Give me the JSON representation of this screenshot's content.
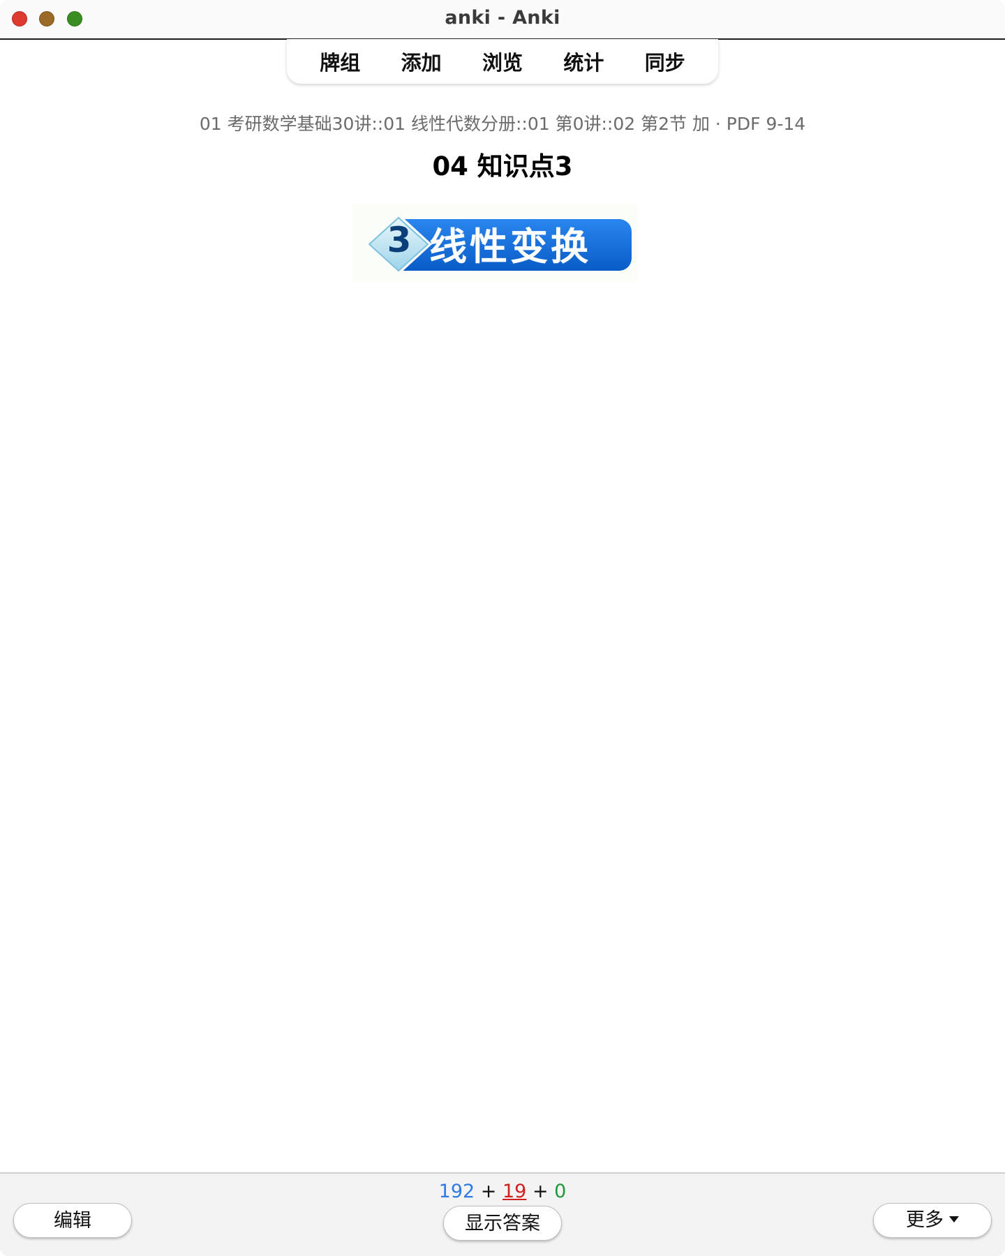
{
  "window": {
    "title": "anki - Anki"
  },
  "toolbar": {
    "items": [
      {
        "label": "牌组"
      },
      {
        "label": "添加"
      },
      {
        "label": "浏览"
      },
      {
        "label": "统计"
      },
      {
        "label": "同步"
      }
    ]
  },
  "card": {
    "deck_path": "01 考研数学基础30讲::01 线性代数分册::01 第0讲::02 第2节 加 · PDF 9-14",
    "title": "04 知识点3",
    "image": {
      "number": "3",
      "label": "线性变换"
    }
  },
  "bottombar": {
    "counts": {
      "new": "192",
      "learning": "19",
      "review": "0",
      "separator": "+"
    },
    "edit_label": "编辑",
    "show_answer_label": "显示答案",
    "more_label": "更多"
  },
  "colors": {
    "new": "#2f7ae5",
    "learning": "#d01f1f",
    "review": "#1f9a3a",
    "image_banner": "#0f6bd9"
  },
  "icons": {
    "close": "close-traffic-light-icon",
    "minimize": "minimize-traffic-light-icon",
    "zoom": "zoom-traffic-light-icon",
    "more_caret": "chevron-down-icon"
  }
}
